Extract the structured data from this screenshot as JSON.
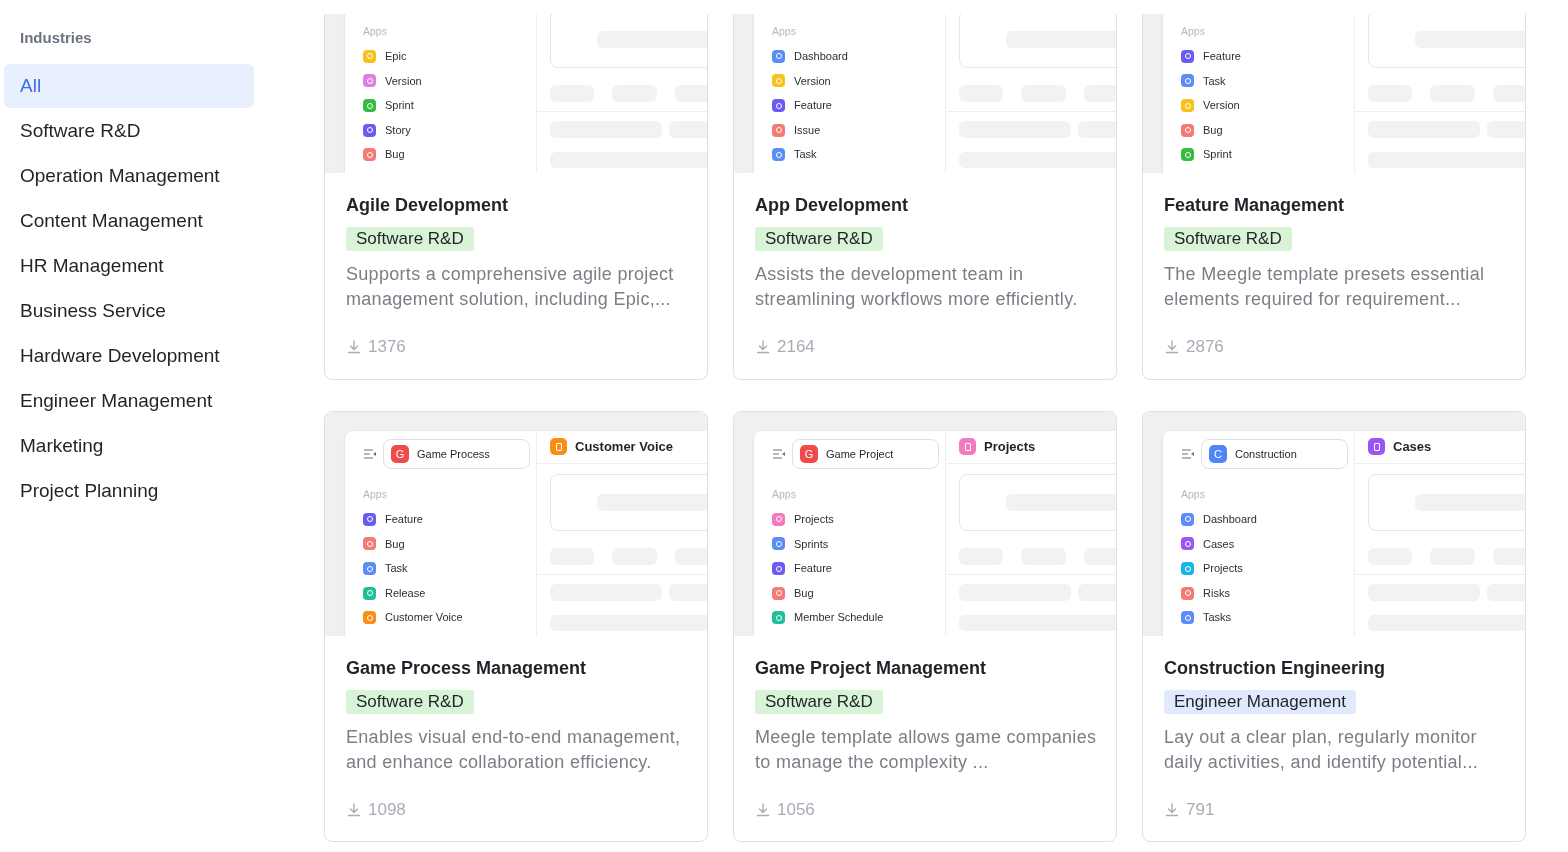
{
  "sidebar": {
    "heading": "Industries",
    "items": [
      {
        "label": "All",
        "selected": true
      },
      {
        "label": "Software R&D",
        "selected": false
      },
      {
        "label": "Operation Management",
        "selected": false
      },
      {
        "label": "Content Management",
        "selected": false
      },
      {
        "label": "HR Management",
        "selected": false
      },
      {
        "label": "Business Service",
        "selected": false
      },
      {
        "label": "Hardware Development",
        "selected": false
      },
      {
        "label": "Engineer Management",
        "selected": false
      },
      {
        "label": "Marketing",
        "selected": false
      },
      {
        "label": "Project Planning",
        "selected": false
      }
    ]
  },
  "templates": [
    {
      "preview": {
        "apps_label": "Apps",
        "apps": [
          {
            "label": "Epic",
            "color": "#f7c21b"
          },
          {
            "label": "Version",
            "color": "#e27ee0"
          },
          {
            "label": "Sprint",
            "color": "#36bd3f"
          },
          {
            "label": "Story",
            "color": "#6a5cf0"
          },
          {
            "label": "Bug",
            "color": "#f47a74"
          }
        ]
      },
      "title": "Agile Development",
      "tag": {
        "label": "Software R&D",
        "color": "#d8f3d6"
      },
      "description": "Supports a comprehensive agile project management solution, including Epic,...",
      "downloads": "1376"
    },
    {
      "preview": {
        "apps_label": "Apps",
        "apps": [
          {
            "label": "Dashboard",
            "color": "#5b8df6"
          },
          {
            "label": "Version",
            "color": "#f7c21b"
          },
          {
            "label": "Feature",
            "color": "#6a5cf0"
          },
          {
            "label": "Issue",
            "color": "#f47a74"
          },
          {
            "label": "Task",
            "color": "#5b8df6"
          }
        ]
      },
      "title": "App Development",
      "tag": {
        "label": "Software R&D",
        "color": "#d8f3d6"
      },
      "description": "Assists the development team in streamlining workflows more efficiently.",
      "downloads": "2164"
    },
    {
      "preview": {
        "apps_label": "Apps",
        "apps": [
          {
            "label": "Feature",
            "color": "#6a5cf0"
          },
          {
            "label": "Task",
            "color": "#5b8df6"
          },
          {
            "label": "Version",
            "color": "#f7c21b"
          },
          {
            "label": "Bug",
            "color": "#f47a74"
          },
          {
            "label": "Sprint",
            "color": "#36bd3f"
          }
        ]
      },
      "title": "Feature Management",
      "tag": {
        "label": "Software R&D",
        "color": "#d8f3d6"
      },
      "description": "The Meegle template presets essential elements required for requirement...",
      "downloads": "2876"
    },
    {
      "preview": {
        "space": {
          "letter": "G",
          "color": "#f04b4b",
          "name": "Game Process"
        },
        "page": {
          "title": "Customer Voice",
          "color": "#fb8c14"
        },
        "apps_label": "Apps",
        "apps": [
          {
            "label": "Feature",
            "color": "#6a5cf0"
          },
          {
            "label": "Bug",
            "color": "#f47a74"
          },
          {
            "label": "Task",
            "color": "#5b8df6"
          },
          {
            "label": "Release",
            "color": "#1fbf9a"
          },
          {
            "label": "Customer Voice",
            "color": "#fb8c14"
          }
        ]
      },
      "title": "Game Process Management",
      "tag": {
        "label": "Software R&D",
        "color": "#d8f3d6"
      },
      "description": "Enables visual end-to-end management, and enhance collaboration efficiency.",
      "downloads": "1098"
    },
    {
      "preview": {
        "space": {
          "letter": "G",
          "color": "#f04b4b",
          "name": "Game Project"
        },
        "page": {
          "title": "Projects",
          "color": "#f27ac0"
        },
        "apps_label": "Apps",
        "apps": [
          {
            "label": "Projects",
            "color": "#f27ac0"
          },
          {
            "label": "Sprints",
            "color": "#5b8df6"
          },
          {
            "label": "Feature",
            "color": "#6a5cf0"
          },
          {
            "label": "Bug",
            "color": "#f47a74"
          },
          {
            "label": "Member Schedule",
            "color": "#1fbf9a"
          }
        ]
      },
      "title": "Game Project Management",
      "tag": {
        "label": "Software R&D",
        "color": "#d8f3d6"
      },
      "description": "Meegle template allows game companies to manage the complexity ...",
      "downloads": "1056"
    },
    {
      "preview": {
        "space": {
          "letter": "C",
          "color": "#4f86f7",
          "name": "Construction"
        },
        "page": {
          "title": "Cases",
          "color": "#9a55f2"
        },
        "apps_label": "Apps",
        "apps": [
          {
            "label": "Dashboard",
            "color": "#5b8df6"
          },
          {
            "label": "Cases",
            "color": "#9a55f2"
          },
          {
            "label": "Projects",
            "color": "#19b5e8"
          },
          {
            "label": "Risks",
            "color": "#f47a74"
          },
          {
            "label": "Tasks",
            "color": "#5b8df6"
          }
        ]
      },
      "title": "Construction Engineering",
      "tag": {
        "label": "Engineer Management",
        "color": "#e1eafc"
      },
      "description": "Lay out a clear plan, regularly monitor daily activities, and identify potential...",
      "downloads": "791"
    }
  ]
}
